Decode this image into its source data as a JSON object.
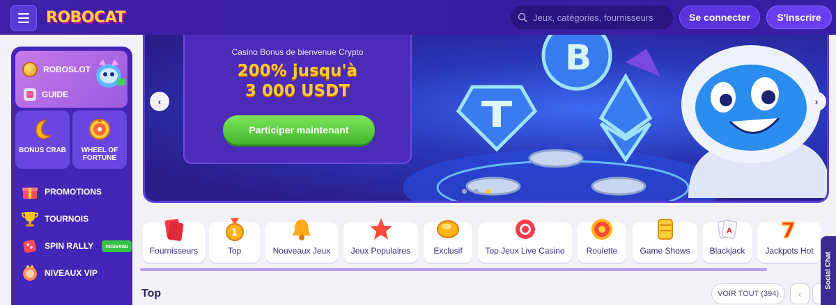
{
  "header": {
    "logo_text": "ROBOCAT",
    "search_placeholder": "Jeux, catégories, fournisseurs",
    "login_label": "Se connecter",
    "signup_label": "S'inscrire"
  },
  "sidebar": {
    "featured": [
      {
        "label": "ROBOSLOT",
        "icon": "coin-icon"
      },
      {
        "label": "GUIDE",
        "icon": "guide-icon"
      }
    ],
    "tiles": [
      {
        "label": "BONUS CRAB",
        "icon": "crab-icon"
      },
      {
        "label": "WHEEL OF FORTUNE",
        "icon": "wheel-icon"
      }
    ],
    "items": [
      {
        "label": "PROMOTIONS",
        "icon": "gift-icon"
      },
      {
        "label": "TOURNOIS",
        "icon": "trophy-icon"
      },
      {
        "label": "SPIN RALLY",
        "icon": "dice-icon",
        "badge": "nouveau"
      },
      {
        "label": "NIVEAUX VIP",
        "icon": "vip-icon"
      }
    ]
  },
  "banner": {
    "subtitle": "Casino Bonus de bienvenue Crypto",
    "title_line1": "200% jusqu'à",
    "title_line2": "3 000 USDT",
    "cta_label": "Participer maintenant",
    "active_slide": 3,
    "slide_count": 3
  },
  "categories": [
    {
      "label": "Fournisseurs",
      "icon": "providers-icon"
    },
    {
      "label": "Top",
      "icon": "medal-icon"
    },
    {
      "label": "Nouveaux Jeux",
      "icon": "bell-icon"
    },
    {
      "label": "Jeux Populaires",
      "icon": "star-icon"
    },
    {
      "label": "Exclusif",
      "icon": "gem-icon"
    },
    {
      "label": "Top Jeux Live Casino",
      "icon": "chip-icon"
    },
    {
      "label": "Roulette",
      "icon": "roulette-icon"
    },
    {
      "label": "Game Shows",
      "icon": "coins-icon"
    },
    {
      "label": "Blackjack",
      "icon": "cards-icon"
    },
    {
      "label": "Jackpots Hot",
      "icon": "seven-icon"
    }
  ],
  "section": {
    "title": "Top",
    "see_all_label": "VOIR TOUT (394)"
  },
  "social_chat_label": "Social Chat",
  "colors": {
    "header_bg": "#3f1fa8",
    "sidebar_bg": "#4326b8",
    "accent_yellow": "#ffcc2a",
    "cta_green": "#43b72c"
  }
}
